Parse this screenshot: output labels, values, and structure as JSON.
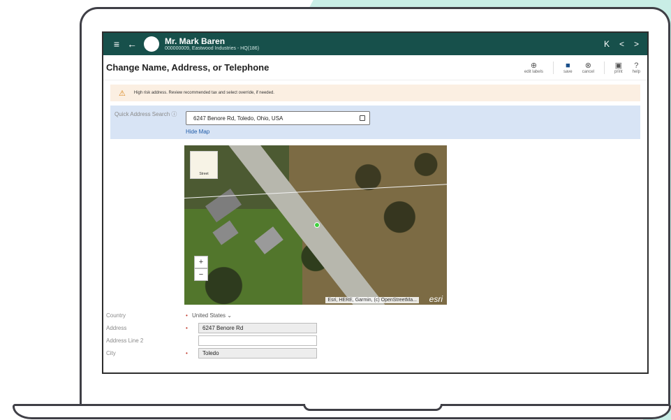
{
  "header": {
    "menu_icon": "hamburger-icon",
    "back_icon": "back-arrow-icon",
    "customer_name": "Mr. Mark Baren",
    "customer_sub": "000000009, Eastwood Industries - HQ(186)",
    "nav": {
      "first": "K",
      "prev": "<",
      "next": ">"
    }
  },
  "page": {
    "title": "Change Name, Address, or Telephone",
    "actions": [
      {
        "icon": "globe-icon",
        "label": "edit labels"
      },
      {
        "icon": "save-icon",
        "label": "save"
      },
      {
        "icon": "cancel-icon",
        "label": "cancel"
      },
      {
        "icon": "print-icon",
        "label": "print"
      },
      {
        "icon": "help-icon",
        "label": "help"
      }
    ]
  },
  "warning": {
    "icon": "warning-triangle-icon",
    "text": "High risk address. Review recommended tax and select override, if needed."
  },
  "quick_search": {
    "label": "Quick Address Search",
    "info_icon": "info-icon",
    "value": "6247 Benore Rd, Toledo, Ohio, USA",
    "hide_map": "Hide Map"
  },
  "map": {
    "basemap_label": "Street",
    "zoom_in": "+",
    "zoom_out": "−",
    "attribution": "Esri, HERE, Garmin, (c) OpenStreetMa...",
    "logo": "esri"
  },
  "form": {
    "country": {
      "label": "Country",
      "value": "United States"
    },
    "address": {
      "label": "Address",
      "value": "6247 Benore Rd"
    },
    "address2": {
      "label": "Address Line 2",
      "value": ""
    },
    "city": {
      "label": "City",
      "value": "Toledo"
    },
    "required_marker": "•"
  }
}
